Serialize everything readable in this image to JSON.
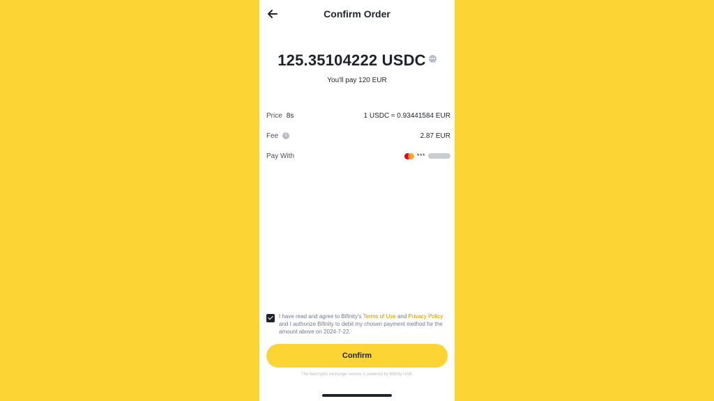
{
  "header": {
    "title": "Confirm Order"
  },
  "order": {
    "amount": "125.35104222 USDC",
    "you_pay": "You'll pay 120 EUR"
  },
  "details": {
    "price_label": "Price",
    "price_timer": "8s",
    "price_value": "1 USDC ≈ 0.93441584 EUR",
    "fee_label": "Fee",
    "fee_value": "2.87 EUR",
    "pay_with_label": "Pay With",
    "card_masked": "***"
  },
  "agreement": {
    "checked": true,
    "text_1": "I have read and agree to Bifinity's ",
    "terms_link": "Terms of Use",
    "text_2": " and ",
    "privacy_link": "Privacy Policy",
    "text_3": " and I authorize Bifinity to debit my chosen payment method for the amount above on 2024-7-22."
  },
  "confirm_label": "Confirm",
  "footnote": "The fiat/crypto exchange service is powered by Bifinity UAB.",
  "colors": {
    "brand_yellow": "#FCD535",
    "link": "#C99400",
    "text": "#1E2329"
  },
  "icons": {
    "back": "arrow-left-icon",
    "more": "more-dots-icon",
    "info": "info-icon",
    "card": "mastercard-icon"
  }
}
